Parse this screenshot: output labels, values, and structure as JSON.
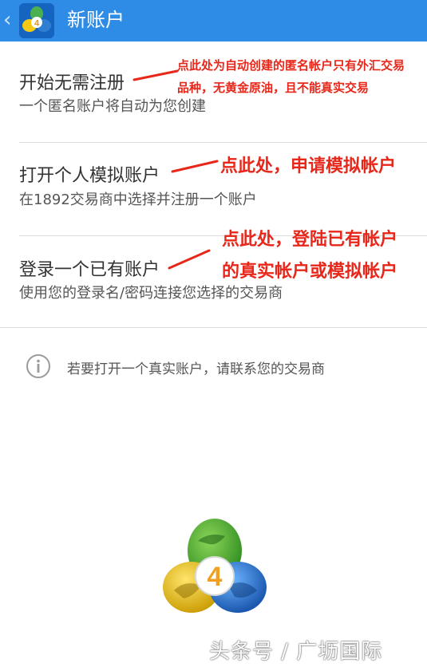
{
  "header": {
    "title": "新账户",
    "back_icon": "chevron-left-icon",
    "app_icon": "metatrader4-icon",
    "background_color": "#2e8be6"
  },
  "options": [
    {
      "title": "开始无需注册",
      "subtitle": "一个匿名账户将自动为您创建"
    },
    {
      "title": "打开个人模拟账户",
      "subtitle": "在1892交易商中选择并注册一个账户"
    },
    {
      "title": "登录一个已有账户",
      "subtitle": "使用您的登录名/密码连接您选择的交易商"
    }
  ],
  "annotations": {
    "color": "#e8271b",
    "anonymous_line1": "点此处为自动创建的匿名帐户只有外汇交易",
    "anonymous_line2": "品种，无黄金原油，且不能真实交易",
    "demo": "点此处，申请模拟帐户",
    "login_line1": "点此处，登陆已有帐户",
    "login_line2": "的真实帐户或模拟帐户"
  },
  "info": {
    "icon": "info-icon",
    "text": "若要打开一个真实账户，请联系您的交易商"
  },
  "logo": {
    "icon": "metatrader4-logo",
    "number": "4"
  },
  "watermark": "头条号 / 广坜国际"
}
